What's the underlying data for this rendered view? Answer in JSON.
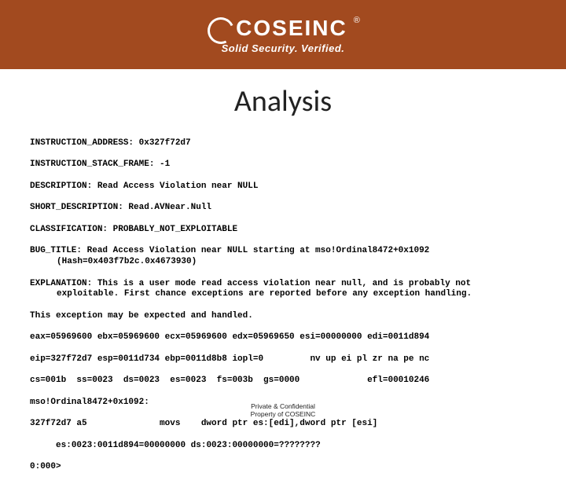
{
  "brand": {
    "name": "COSEINC",
    "registered": "®",
    "tagline": "Solid Security. Verified."
  },
  "title": "Analysis",
  "lines": {
    "l1": "INSTRUCTION_ADDRESS: 0x327f72d7",
    "l2": "INSTRUCTION_STACK_FRAME: -1",
    "l3": "DESCRIPTION: Read Access Violation near NULL",
    "l4": "SHORT_DESCRIPTION: Read.AVNear.Null",
    "l5": "CLASSIFICATION: PROBABLY_NOT_EXPLOITABLE",
    "l6": "BUG_TITLE: Read Access Violation near NULL starting at mso!Ordinal8472+0x1092 (Hash=0x403f7b2c.0x4673930)",
    "l7": "EXPLANATION: This is a user mode read access violation near null, and is probably not exploitable. First chance exceptions are reported before any exception handling.",
    "l8": "This exception may be expected and handled.",
    "l9": "eax=05969600 ebx=05969600 ecx=05969600 edx=05969650 esi=00000000 edi=0011d894",
    "l10": "eip=327f72d7 esp=0011d734 ebp=0011d8b8 iopl=0         nv up ei pl zr na pe nc",
    "l11": "cs=001b  ss=0023  ds=0023  es=0023  fs=003b  gs=0000             efl=00010246",
    "l12": "mso!Ordinal8472+0x1092:",
    "l13": "327f72d7 a5              movs    dword ptr es:[edi],dword ptr [esi]",
    "l14": "     es:0023:0011d894=00000000 ds:0023:00000000=????????",
    "l15": "0:000>"
  },
  "footer": {
    "l1": "Private & Confidential",
    "l2": "Property of COSEINC"
  }
}
